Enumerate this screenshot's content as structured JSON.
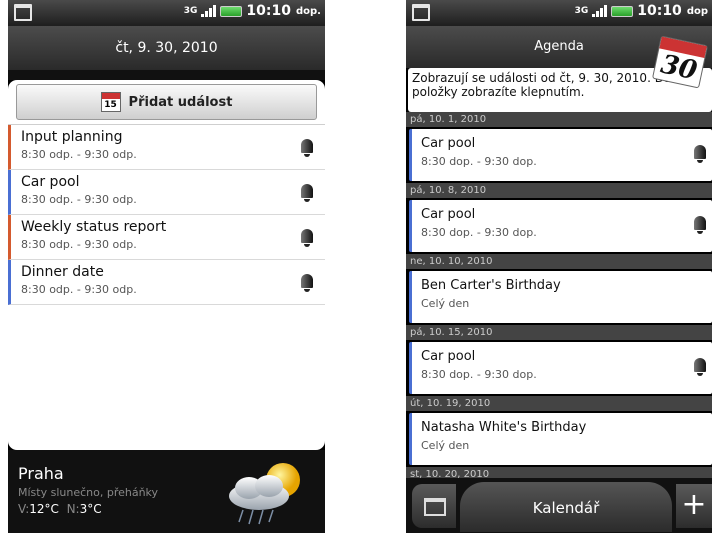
{
  "status": {
    "network": "3G",
    "time": "10:10",
    "ampm": "dop.",
    "ampm_right": "dop"
  },
  "left": {
    "date": "čt, 9. 30, 2010",
    "add_label": "Přidat událost",
    "add_icon_day": "15",
    "events": [
      {
        "title": "Input planning",
        "time": "8:30 odp. - 9:30 odp.",
        "color": "#d45a2e"
      },
      {
        "title": "Car pool",
        "time": "8:30 odp. - 9:30 odp.",
        "color": "#4a6fd3"
      },
      {
        "title": "Weekly status report",
        "time": "8:30 odp. - 9:30 odp.",
        "color": "#d45a2e"
      },
      {
        "title": "Dinner date",
        "time": "8:30 odp. - 9:30 odp.",
        "color": "#4a6fd3"
      }
    ],
    "weather": {
      "city": "Praha",
      "condition": "Místy slunečno, přeháňky",
      "hi_label": "V:",
      "hi": "12°C",
      "lo_label": "N:",
      "lo": "3°C"
    }
  },
  "right": {
    "title": "Agenda",
    "cal_month": "9",
    "cal_day": "30",
    "info": "Zobrazují se události od čt, 9. 30, 2010. Další položky zobrazíte klepnutím.",
    "days": [
      {
        "date": "pá, 10. 1, 2010",
        "title": "Car pool",
        "time": "8:30 dop. - 9:30 dop.",
        "bell": true
      },
      {
        "date": "pá, 10. 8, 2010",
        "title": "Car pool",
        "time": "8:30 dop. - 9:30 dop.",
        "bell": true
      },
      {
        "date": "ne, 10. 10, 2010",
        "title": "Ben Carter's Birthday",
        "time": "Celý den",
        "bell": false
      },
      {
        "date": "pá, 10. 15, 2010",
        "title": "Car pool",
        "time": "8:30 dop. - 9:30 dop.",
        "bell": true
      },
      {
        "date": "út, 10. 19, 2010",
        "title": "Natasha White's Birthday",
        "time": "Celý den",
        "bell": false
      }
    ],
    "partial_day": "st, 10. 20, 2010",
    "bottom_label": "Kalendář",
    "plus_label": "+"
  }
}
